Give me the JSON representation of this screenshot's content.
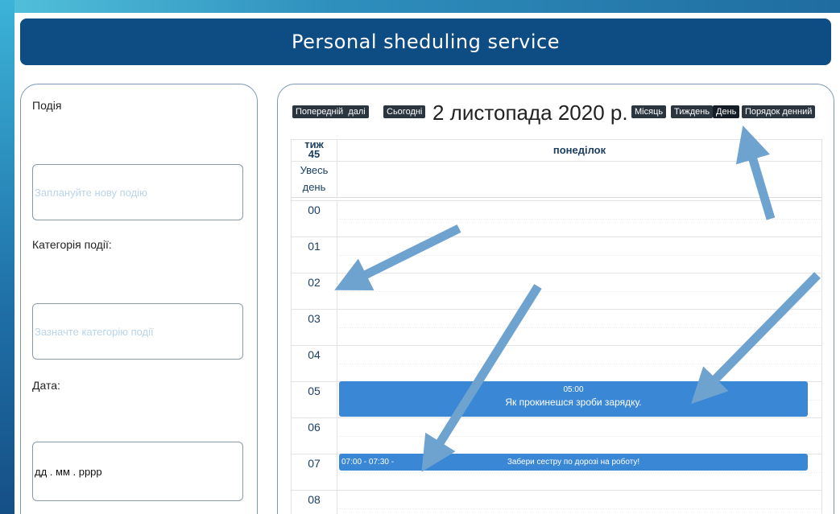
{
  "app": {
    "title": "Personal sheduling service"
  },
  "form": {
    "event_label": "Подія",
    "event_placeholder": "Заплануйте нову подію",
    "category_label": "Категорія події:",
    "category_placeholder": "Зазначте категорію події",
    "date_label": "Дата:",
    "date_value": "дд . мм . рррр"
  },
  "calendar": {
    "prev_label": "Попередній",
    "next_label": "далі",
    "today_label": "Сьогодні",
    "title": "2 листопада 2020 р.",
    "views": [
      {
        "label": "Місяць",
        "active": false
      },
      {
        "label": "Тиждень",
        "active": false
      },
      {
        "label": "День",
        "active": true
      },
      {
        "label": "Порядок денний",
        "active": false
      }
    ],
    "week_label_line1": "тиж",
    "week_label_line2": "45",
    "day_header": "понеділок",
    "allday_line1": "Увесь",
    "allday_line2": "день",
    "hours": [
      "00",
      "01",
      "02",
      "03",
      "04",
      "05",
      "06",
      "07",
      "08"
    ],
    "events": [
      {
        "time": "05:00",
        "title": "Як прокинешся зроби зарядку."
      },
      {
        "time": "07:00 - 07:30 -",
        "title": "Забери сестру по дорозі на роботу!"
      }
    ]
  },
  "colors": {
    "banner": "#0e4c84",
    "event": "#3a87d6",
    "arrow": "#6fa3cf",
    "button": "#2a3540"
  }
}
